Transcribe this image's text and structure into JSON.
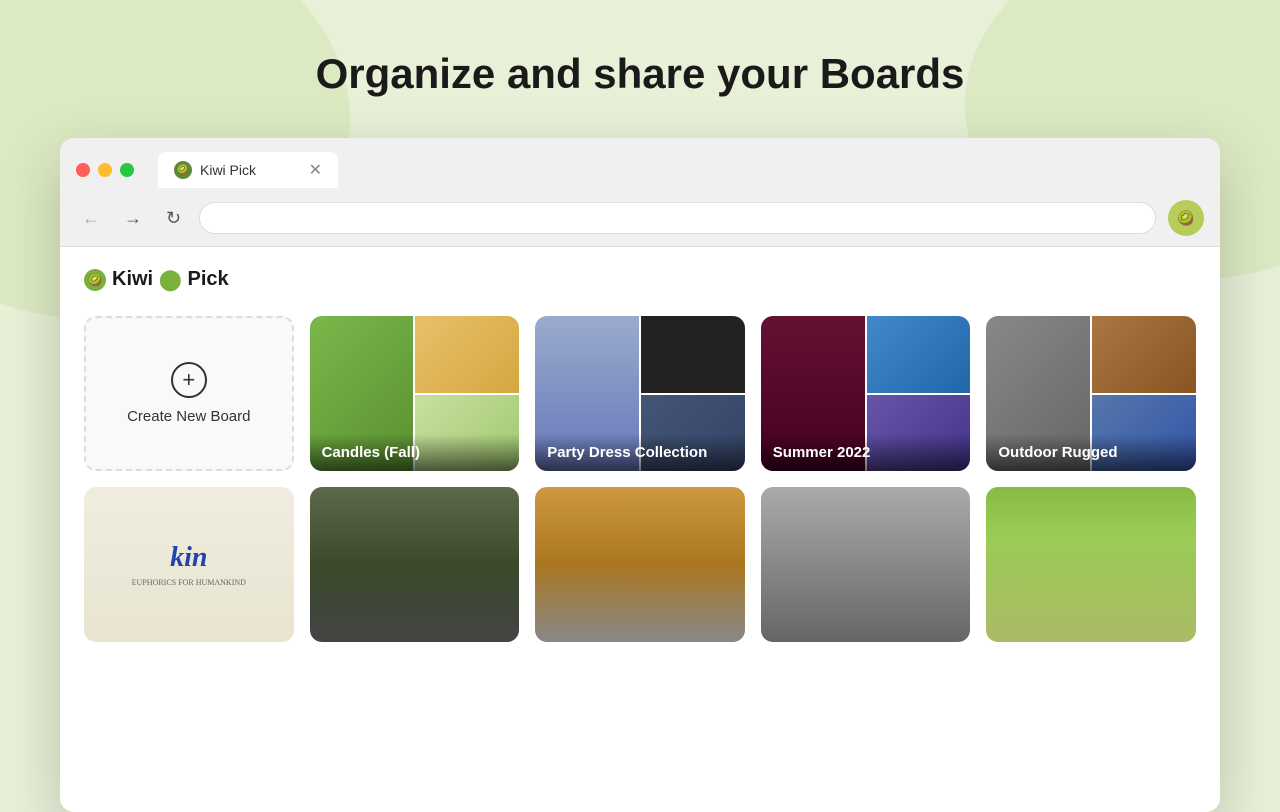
{
  "page": {
    "title": "Organize and share your Boards"
  },
  "browser": {
    "tab_title": "Kiwi Pick",
    "tab_close": "✕",
    "nav_back": "←",
    "nav_forward": "→",
    "nav_refresh": "↻",
    "profile_icon": "🥝"
  },
  "app": {
    "logo_text": "KiwiPick",
    "logo_icon": "🥝"
  },
  "row1": {
    "create_label": "Create New Board",
    "boards": [
      {
        "name": "Candles (Fall)",
        "id": "candles"
      },
      {
        "name": "Party Dress Collection",
        "id": "party"
      },
      {
        "name": "Summer 2022",
        "id": "summer"
      },
      {
        "name": "Outdoor Rugged",
        "id": "outdoor"
      }
    ]
  },
  "row2": {
    "boards": [
      {
        "name": "",
        "id": "kin"
      },
      {
        "name": "",
        "id": "jacket1"
      },
      {
        "name": "",
        "id": "jacket2"
      },
      {
        "name": "",
        "id": "street"
      },
      {
        "name": "",
        "id": "green"
      }
    ]
  }
}
